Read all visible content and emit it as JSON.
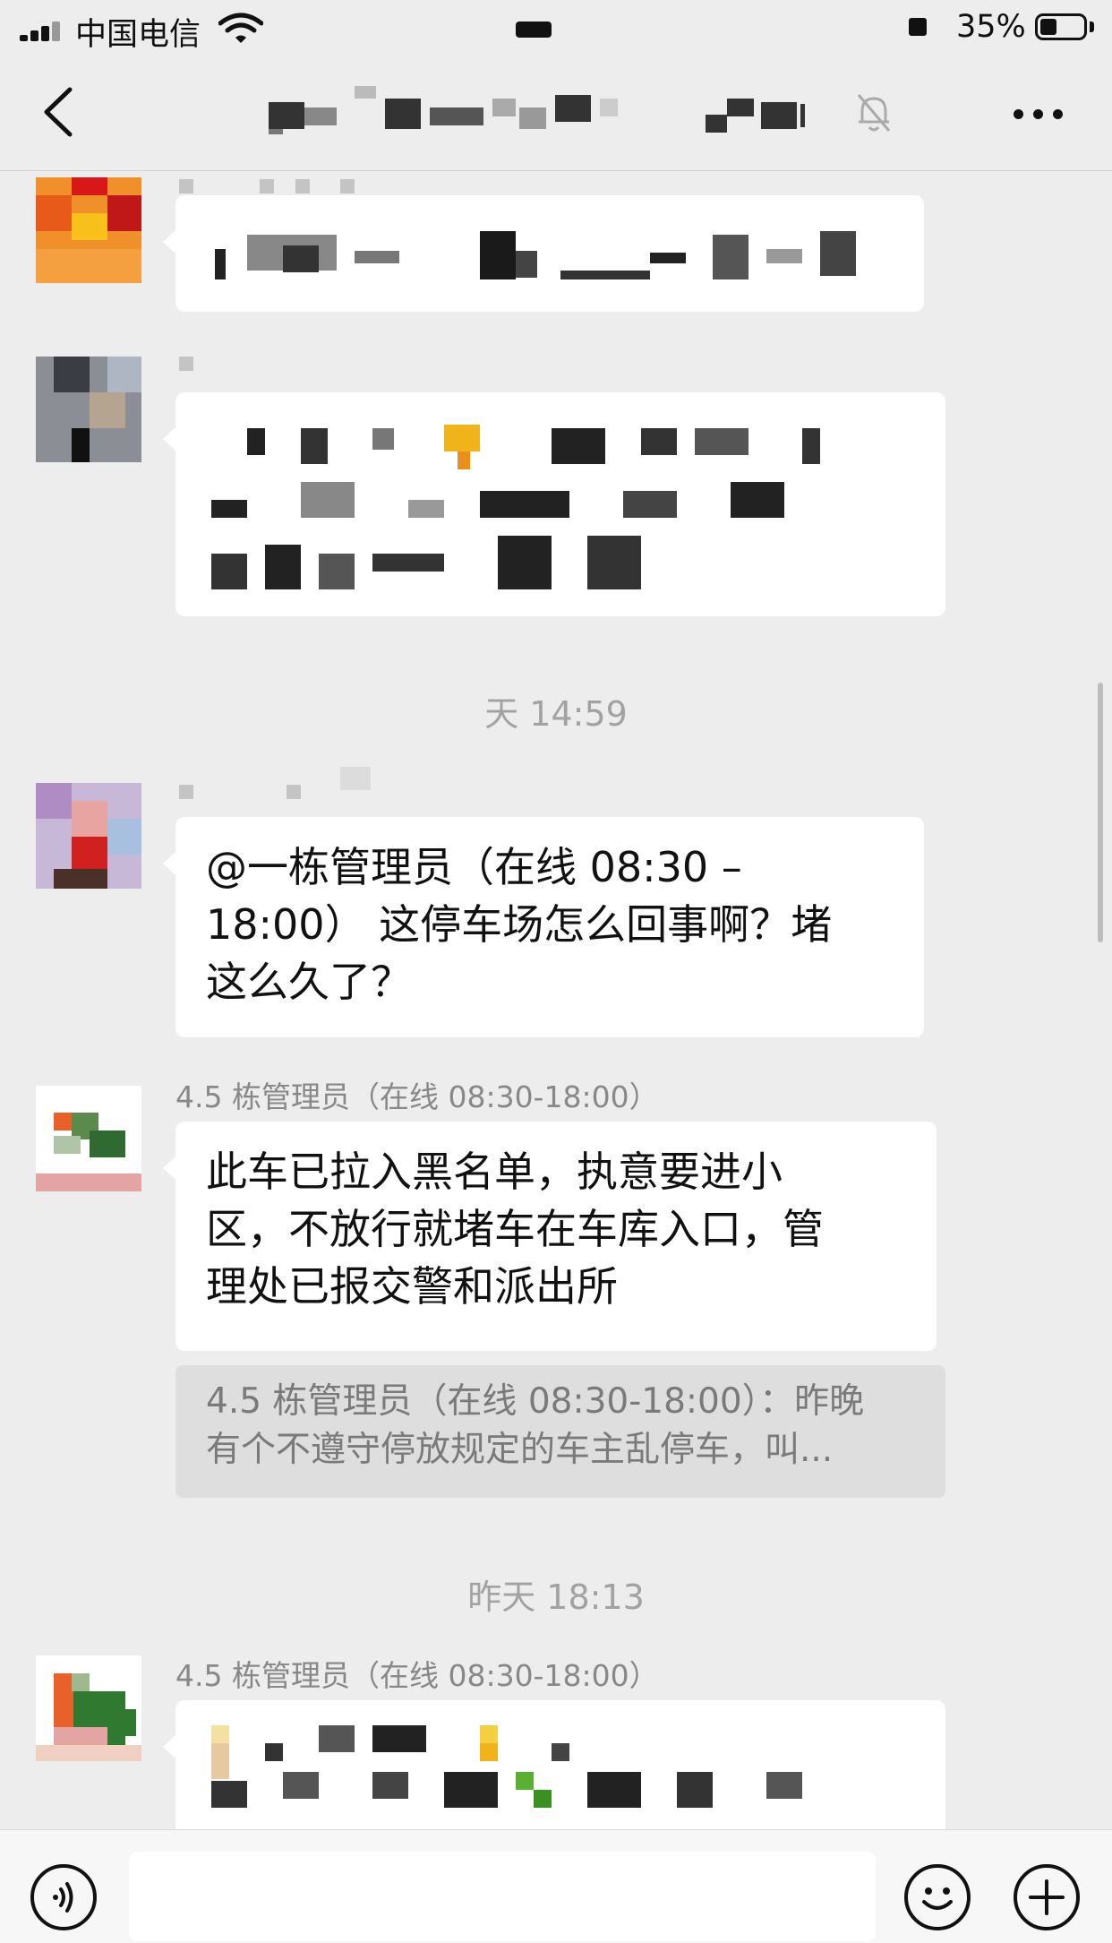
{
  "status_bar": {
    "carrier": "中国电信",
    "battery_percent": "35%",
    "battery_level": 0.35
  },
  "nav": {
    "title_obscured": true,
    "muted": true
  },
  "messages": [
    {
      "sender_obscured": true,
      "text_obscured": true
    },
    {
      "sender_obscured": true,
      "text_obscured": true
    },
    {
      "time_separator": "天 14:59",
      "sender_obscured": true,
      "text": "@一栋管理员（在线 08:30 –\n18:00） 这停车场怎么回事啊？堵\n这么久了？"
    },
    {
      "sender": "4.5 栋管理员（在线 08:30-18:00）",
      "text": "此车已拉入黑名单，执意要进小\n区，不放行就堵车在车库入口，管\n理处已报交警和派出所",
      "quote": "4.5 栋管理员（在线 08:30-18:00）：昨晚\n有个不遵守停放规定的车主乱停车，叫..."
    },
    {
      "time_separator": "昨天 18:13",
      "sender": "4.5 栋管理员（在线 08:30-18:00）",
      "text_obscured": true
    }
  ],
  "bottom_bar": {
    "voice_icon": "voice-icon",
    "emoji_icon": "emoji-icon",
    "plus_icon": "plus-icon"
  }
}
